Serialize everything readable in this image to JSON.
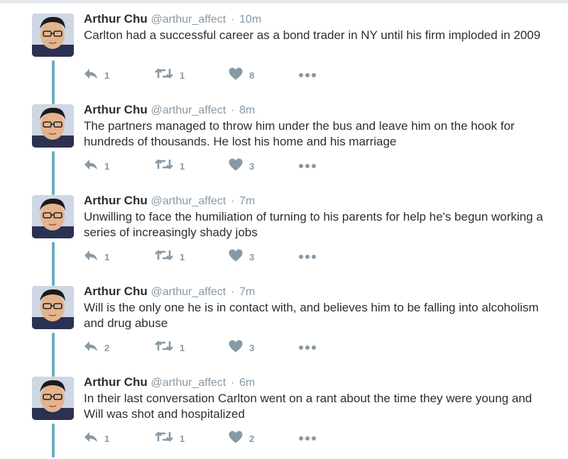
{
  "author": {
    "name": "Arthur Chu",
    "handle": "@arthur_affect",
    "separator": "·"
  },
  "colors": {
    "thread_line": "#6aaebe",
    "meta_gray": "#8899a6",
    "text": "#292f33"
  },
  "icons": [
    "reply-icon",
    "retweet-icon",
    "heart-icon",
    "more-icon"
  ],
  "tweets": [
    {
      "time": "10m",
      "text": "Carlton had a successful career as a bond trader in NY until his firm imploded in 2009",
      "replies": "1",
      "retweets": "1",
      "likes": "8"
    },
    {
      "time": "8m",
      "text": "The partners managed to throw him under the bus and leave him on the hook for hundreds of thousands. He lost his home and his marriage",
      "replies": "1",
      "retweets": "1",
      "likes": "3"
    },
    {
      "time": "7m",
      "text": "Unwilling to face the humiliation of turning to his parents for help he's begun working a series of increasingly shady jobs",
      "replies": "1",
      "retweets": "1",
      "likes": "3"
    },
    {
      "time": "7m",
      "text": "Will is the only one he is in contact with, and believes him to be falling into alcoholism and drug abuse",
      "replies": "2",
      "retweets": "1",
      "likes": "3"
    },
    {
      "time": "6m",
      "text": "In their last conversation Carlton went on a rant about the time they were young and Will was shot and hospitalized",
      "replies": "1",
      "retweets": "1",
      "likes": "2"
    }
  ]
}
